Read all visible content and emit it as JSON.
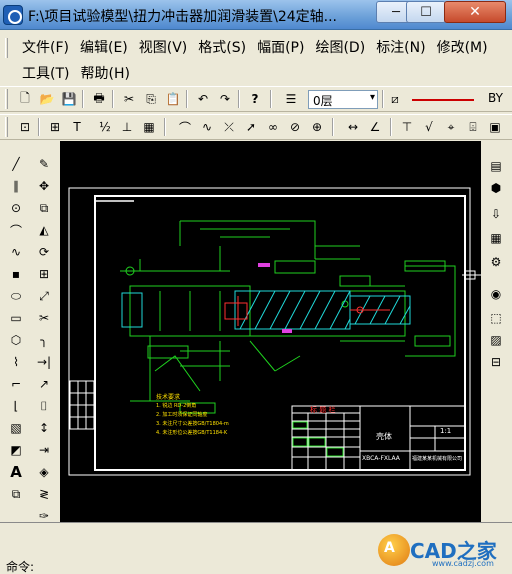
{
  "window": {
    "title": "F:\\项目试验模型\\扭力冲击器加润滑装置\\24定轴...",
    "minimize": "─",
    "maximize": "☐",
    "close": "✕"
  },
  "menu": {
    "row1": [
      "文件(F)",
      "编辑(E)",
      "视图(V)",
      "格式(S)",
      "幅面(P)",
      "绘图(D)",
      "标注(N)",
      "修改(M)"
    ],
    "row2": [
      "工具(T)",
      "帮助(H)"
    ]
  },
  "toolbar": {
    "layer_value": "0层",
    "layer_arrow": "▾",
    "line_code": "BY"
  },
  "drawing": {
    "title_block": "标 题 栏",
    "part_name": "壳体",
    "scale": "1:1",
    "company": "福建某某机械有限公司",
    "drawing_no": "XBCA-FXLAA",
    "notes_title": "技术要求",
    "note1": "1. 锐边 RD-2倒角",
    "note2": "2. 加工时须保证同轴度",
    "note3": "3. 未注尺寸公差按GB/T1804-m",
    "note4": "4. 未注形位公差按GB/T1184-K"
  },
  "command": {
    "label": "命令:"
  },
  "watermark": {
    "logo": "A",
    "text": "CAD之家",
    "url": "www.cadzj.com"
  }
}
